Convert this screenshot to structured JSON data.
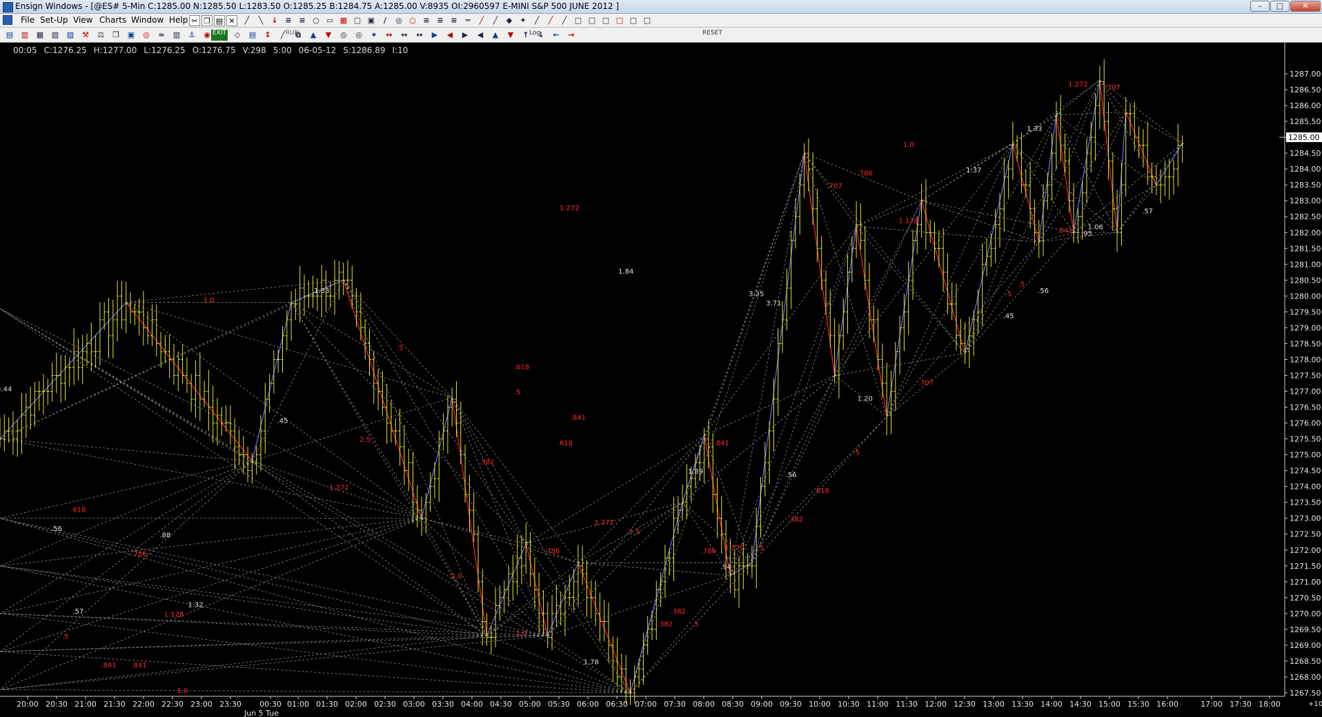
{
  "window": {
    "title": "Ensign Windows - [@ES# 5-Min C:1285.00 N:1285.50 L:1283.50 O:1285.25 B:1284.75 A:1285.00 V:8935 OI:2960597 E-MINI S&P 500 JUNE 2012 ]",
    "min_label": "–",
    "max_label": "□",
    "close_label": "✕"
  },
  "menu": {
    "items": [
      "File",
      "Set-Up",
      "View",
      "Charts",
      "Window",
      "Help"
    ]
  },
  "toolbar": {
    "run_label": "RUN",
    "log_label": "Log",
    "reset_label": "RESET",
    "exit_label": "EXIT"
  },
  "readout": {
    "time": "00:05",
    "close": "C:1276.25",
    "high": "H:1277.00",
    "low": "L:1276.25",
    "open": "O:1276.75",
    "volume": "V:298",
    "interval": "5:00",
    "date": "06-05-12",
    "s": "S:1286.89",
    "i": "I:10"
  },
  "chart_data": {
    "type": "ohlc",
    "symbol": "@ES# 5-Min",
    "price_axis": {
      "min": 1267.5,
      "max": 1287.0,
      "step": 0.5,
      "current_price_label": "1285.00"
    },
    "time_axis": {
      "ticks": [
        "20:00",
        "20:30",
        "21:00",
        "21:30",
        "22:00",
        "22:30",
        "23:00",
        "23:30",
        "00:30",
        "01:00",
        "01:30",
        "02:00",
        "02:30",
        "03:00",
        "03:30",
        "04:00",
        "04:30",
        "05:00",
        "05:30",
        "06:00",
        "06:30",
        "07:00",
        "07:30",
        "08:00",
        "08:30",
        "09:00",
        "09:30",
        "10:00",
        "10:30",
        "11:00",
        "11:30",
        "12:00",
        "12:30",
        "13:00",
        "13:30",
        "14:00",
        "14:30",
        "15:00",
        "15:30",
        "16:00",
        "17:00",
        "17:30",
        "18:00"
      ],
      "date_label": "Jun 5 Tue",
      "right_label": "+10"
    },
    "swings": [
      {
        "i": 0,
        "p": 1275.5
      },
      {
        "i": 29,
        "p": 1279.8
      },
      {
        "i": 58,
        "p": 1274.8
      },
      {
        "i": 67,
        "p": 1279.8
      },
      {
        "i": 79,
        "p": 1280.5
      },
      {
        "i": 97,
        "p": 1273.0
      },
      {
        "i": 104,
        "p": 1276.8
      },
      {
        "i": 112,
        "p": 1269.3
      },
      {
        "i": 121,
        "p": 1272.2
      },
      {
        "i": 126,
        "p": 1269.3
      },
      {
        "i": 133,
        "p": 1271.6
      },
      {
        "i": 145,
        "p": 1267.5
      },
      {
        "i": 157,
        "p": 1273.5
      },
      {
        "i": 162,
        "p": 1275.6
      },
      {
        "i": 168,
        "p": 1271.2
      },
      {
        "i": 173,
        "p": 1271.6
      },
      {
        "i": 185,
        "p": 1284.5
      },
      {
        "i": 192,
        "p": 1277.5
      },
      {
        "i": 197,
        "p": 1282.2
      },
      {
        "i": 204,
        "p": 1276.2
      },
      {
        "i": 212,
        "p": 1283.0
      },
      {
        "i": 222,
        "p": 1278.2
      },
      {
        "i": 233,
        "p": 1284.8
      },
      {
        "i": 239,
        "p": 1281.7
      },
      {
        "i": 243,
        "p": 1285.7
      },
      {
        "i": 247,
        "p": 1282.0
      },
      {
        "i": 253,
        "p": 1286.8
      },
      {
        "i": 257,
        "p": 1282.0
      },
      {
        "i": 259,
        "p": 1285.8
      },
      {
        "i": 266,
        "p": 1283.5
      },
      {
        "i": 272,
        "p": 1284.8
      }
    ],
    "fib_labels": [
      {
        "text": "1.0",
        "color": "red",
        "i": 48,
        "p": 1279.8
      },
      {
        "text": "1.33",
        "color": "white",
        "i": 74,
        "p": 1280.1
      },
      {
        "text": "1.272",
        "color": "red",
        "i": 131,
        "p": 1282.7
      },
      {
        "text": "1.84",
        "color": "white",
        "i": 144,
        "p": 1280.7
      },
      {
        "text": "1.0",
        "color": "red",
        "i": 209,
        "p": 1284.7
      },
      {
        "text": "1.33",
        "color": "white",
        "i": 238,
        "p": 1285.2
      },
      {
        "text": "1.272",
        "color": "red",
        "i": 248,
        "p": 1286.6
      },
      {
        "text": ".707",
        "color": "red",
        "i": 256,
        "p": 1286.5
      },
      {
        "text": "3.44",
        "color": "white",
        "i": 1,
        "p": 1277.0
      },
      {
        "text": ".45",
        "color": "white",
        "i": 65,
        "p": 1276.0
      },
      {
        "text": ".5",
        "color": "red",
        "i": 92,
        "p": 1278.3
      },
      {
        "text": ".618",
        "color": "red",
        "i": 120,
        "p": 1277.7
      },
      {
        "text": ".5",
        "color": "red",
        "i": 119,
        "p": 1276.9
      },
      {
        "text": ".841",
        "color": "red",
        "i": 133,
        "p": 1276.1
      },
      {
        "text": ".618",
        "color": "red",
        "i": 130,
        "p": 1275.3
      },
      {
        "text": "2.5",
        "color": "red",
        "i": 84,
        "p": 1275.4
      },
      {
        "text": "1.272",
        "color": "red",
        "i": 78,
        "p": 1273.9
      },
      {
        "text": ".382",
        "color": "red",
        "i": 112,
        "p": 1274.7
      },
      {
        "text": ".618",
        "color": "red",
        "i": 18,
        "p": 1273.2
      },
      {
        "text": ".56",
        "color": "white",
        "i": 13,
        "p": 1272.6
      },
      {
        "text": ".88",
        "color": "white",
        "i": 38,
        "p": 1272.4
      },
      {
        "text": ".786",
        "color": "red",
        "i": 32,
        "p": 1271.8
      },
      {
        "text": "1.32",
        "color": "white",
        "i": 45,
        "p": 1270.2
      },
      {
        "text": ".57",
        "color": "white",
        "i": 18,
        "p": 1270.0
      },
      {
        "text": "1.128",
        "color": "red",
        "i": 40,
        "p": 1269.9
      },
      {
        "text": ".5",
        "color": "red",
        "i": 15,
        "p": 1269.2
      },
      {
        "text": ".841",
        "color": "red",
        "i": 25,
        "p": 1268.3
      },
      {
        "text": ".841",
        "color": "red",
        "i": 32,
        "p": 1268.3
      },
      {
        "text": "1.0",
        "color": "red",
        "i": 42,
        "p": 1267.5
      },
      {
        "text": "2.0",
        "color": "red",
        "i": 105,
        "p": 1271.1
      },
      {
        "text": "1.0",
        "color": "red",
        "i": 120,
        "p": 1269.3
      },
      {
        "text": ".786",
        "color": "red",
        "i": 127,
        "p": 1271.9
      },
      {
        "text": "1.272",
        "color": "red",
        "i": 139,
        "p": 1272.8
      },
      {
        "text": "1.5",
        "color": "red",
        "i": 146,
        "p": 1272.5
      },
      {
        "text": "1.78",
        "color": "white",
        "i": 136,
        "p": 1268.4
      },
      {
        "text": ".382",
        "color": "red",
        "i": 156,
        "p": 1270.0
      },
      {
        "text": ".382",
        "color": "red",
        "i": 153,
        "p": 1269.6
      },
      {
        "text": ".5",
        "color": "red",
        "i": 160,
        "p": 1269.6
      },
      {
        "text": "1.89",
        "color": "white",
        "i": 160,
        "p": 1274.4
      },
      {
        "text": ".841",
        "color": "red",
        "i": 166,
        "p": 1275.3
      },
      {
        "text": ".786",
        "color": "red",
        "i": 163,
        "p": 1271.9
      },
      {
        "text": "1.272",
        "color": "red",
        "i": 169,
        "p": 1272.0
      },
      {
        "text": ".94",
        "color": "white",
        "i": 167,
        "p": 1271.4
      },
      {
        "text": ".5",
        "color": "red",
        "i": 175,
        "p": 1272.0
      },
      {
        "text": "3.25",
        "color": "white",
        "i": 174,
        "p": 1280.0
      },
      {
        "text": "3.71",
        "color": "white",
        "i": 178,
        "p": 1279.7
      },
      {
        "text": ".56",
        "color": "white",
        "i": 182,
        "p": 1274.3
      },
      {
        "text": ".707",
        "color": "red",
        "i": 192,
        "p": 1283.4
      },
      {
        "text": ".786",
        "color": "red",
        "i": 199,
        "p": 1283.8
      },
      {
        "text": "1.128",
        "color": "red",
        "i": 209,
        "p": 1282.3
      },
      {
        "text": "1.20",
        "color": "white",
        "i": 199,
        "p": 1276.7
      },
      {
        "text": ".707",
        "color": "red",
        "i": 213,
        "p": 1277.2
      },
      {
        "text": ".5",
        "color": "red",
        "i": 197,
        "p": 1275.0
      },
      {
        "text": ".618",
        "color": "red",
        "i": 189,
        "p": 1273.8
      },
      {
        "text": ".382",
        "color": "red",
        "i": 183,
        "p": 1272.9
      },
      {
        "text": "1.37",
        "color": "white",
        "i": 224,
        "p": 1283.9
      },
      {
        "text": ".5",
        "color": "red",
        "i": 232,
        "p": 1280.0
      },
      {
        "text": ".5",
        "color": "red",
        "i": 235,
        "p": 1280.3
      },
      {
        "text": ".56",
        "color": "white",
        "i": 240,
        "p": 1280.1
      },
      {
        "text": ".45",
        "color": "white",
        "i": 232,
        "p": 1279.3
      },
      {
        "text": ".841",
        "color": "red",
        "i": 245,
        "p": 1282.0
      },
      {
        "text": ".95",
        "color": "white",
        "i": 250,
        "p": 1281.9
      },
      {
        "text": "1.06",
        "color": "white",
        "i": 252,
        "p": 1282.1
      },
      {
        "text": ".57",
        "color": "white",
        "i": 264,
        "p": 1282.6
      }
    ]
  }
}
